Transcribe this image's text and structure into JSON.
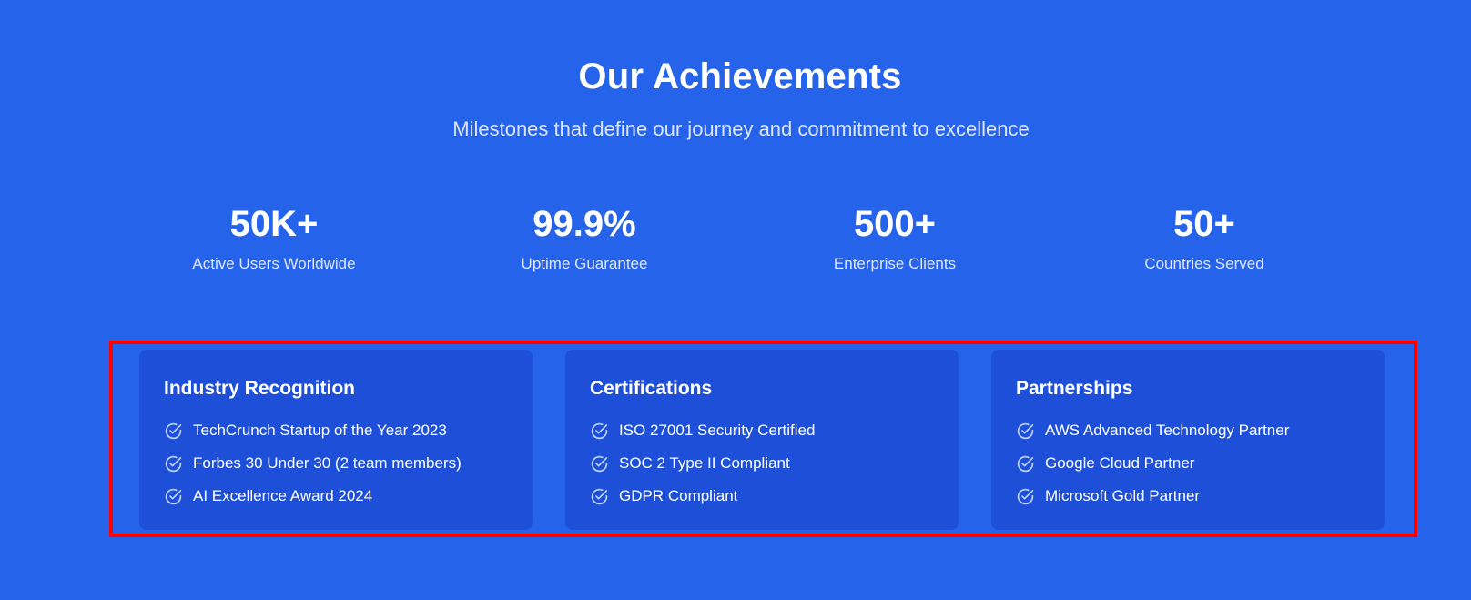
{
  "header": {
    "title": "Our Achievements",
    "subtitle": "Milestones that define our journey and commitment to excellence"
  },
  "stats": [
    {
      "value": "50K+",
      "label": "Active Users Worldwide"
    },
    {
      "value": "99.9%",
      "label": "Uptime Guarantee"
    },
    {
      "value": "500+",
      "label": "Enterprise Clients"
    },
    {
      "value": "50+",
      "label": "Countries Served"
    }
  ],
  "cards": [
    {
      "title": "Industry Recognition",
      "items": [
        "TechCrunch Startup of the Year 2023",
        "Forbes 30 Under 30 (2 team members)",
        "AI Excellence Award 2024"
      ]
    },
    {
      "title": "Certifications",
      "items": [
        "ISO 27001 Security Certified",
        "SOC 2 Type II Compliant",
        "GDPR Compliant"
      ]
    },
    {
      "title": "Partnerships",
      "items": [
        "AWS Advanced Technology Partner",
        "Google Cloud Partner",
        "Microsoft Gold Partner"
      ]
    }
  ],
  "icons": {
    "list_item_icon": "check-circle-icon"
  },
  "colors": {
    "background": "#2563eb",
    "card_background": "#1e4fd8",
    "highlight_border": "#ff0000",
    "muted_text": "#dbe5fd",
    "icon": "#bcd0fb"
  }
}
